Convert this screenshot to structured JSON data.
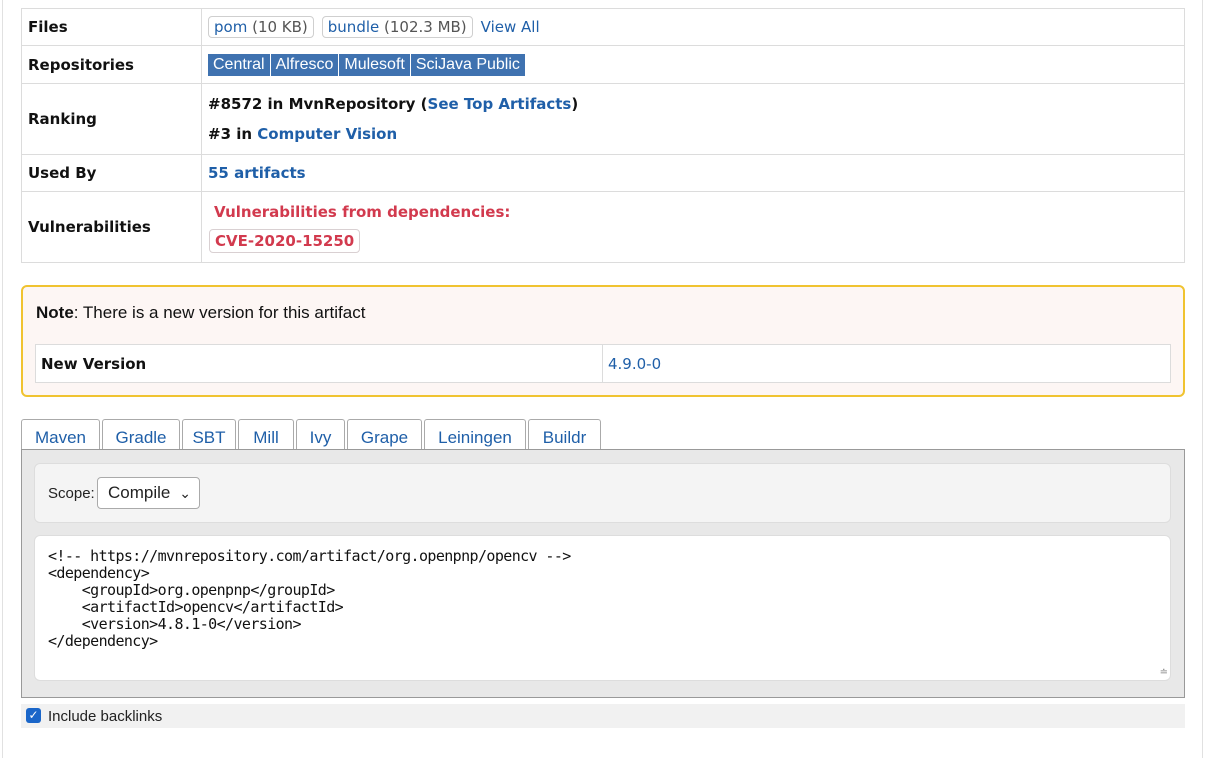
{
  "info": {
    "files_label": "Files",
    "files": [
      {
        "name": "pom",
        "size": "(10 KB)"
      },
      {
        "name": "bundle",
        "size": "(102.3 MB)"
      }
    ],
    "view_all": "View All",
    "repositories_label": "Repositories",
    "repositories": [
      "Central",
      "Alfresco",
      "Mulesoft",
      "SciJava Public"
    ],
    "ranking_label": "Ranking",
    "ranking": {
      "line1_prefix": "#8572 in MvnRepository (",
      "line1_link": "See Top Artifacts",
      "line1_suffix": ")",
      "line2_prefix": "#3 in ",
      "line2_link": "Computer Vision"
    },
    "used_by_label": "Used By",
    "used_by": "55 artifacts",
    "vulnerabilities_label": "Vulnerabilities",
    "vulnerabilities_heading": "Vulnerabilities from dependencies:",
    "cve": "CVE-2020-15250"
  },
  "note": {
    "bold": "Note",
    "text": ": There is a new version for this artifact",
    "new_version_label": "New Version",
    "new_version_value": "4.9.0-0"
  },
  "tabs": [
    "Maven",
    "Gradle",
    "SBT",
    "Mill",
    "Ivy",
    "Grape",
    "Leiningen",
    "Buildr"
  ],
  "active_tab": "Maven",
  "scope": {
    "label": "Scope:",
    "value": "Compile"
  },
  "snippet": "<!-- https://mvnrepository.com/artifact/org.openpnp/opencv -->\n<dependency>\n    <groupId>org.openpnp</groupId>\n    <artifactId>opencv</artifactId>\n    <version>4.8.1-0</version>\n</dependency>",
  "backlinks": {
    "label": "Include backlinks",
    "checked": true
  },
  "colors": {
    "link": "#1f5fa8",
    "repo_badge": "#3f72b0",
    "vuln": "#d23a4e",
    "note_border": "#f0c330"
  }
}
